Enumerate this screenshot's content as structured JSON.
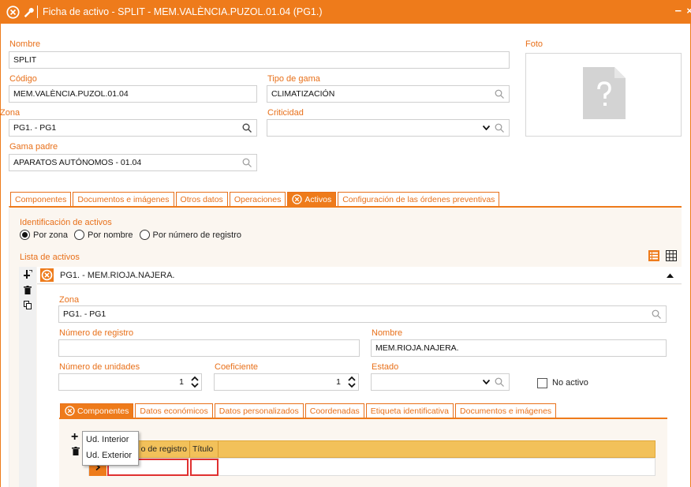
{
  "window": {
    "title": "Ficha de activo -  SPLIT - MEM.VALÈNCIA.PUZOL.01.04 (PG1.)",
    "minimize": "–",
    "close": "×"
  },
  "form": {
    "nombre_label": "Nombre",
    "nombre_value": "SPLIT",
    "codigo_label": "Código",
    "codigo_value": "MEM.VALÈNCIA.PUZOL.01.04",
    "tipo_gama_label": "Tipo de gama",
    "tipo_gama_value": "CLIMATIZACIÓN",
    "zona_label": "Zona",
    "zona_value": "PG1. - PG1",
    "criticidad_label": "Criticidad",
    "criticidad_value": "",
    "gama_padre_label": "Gama padre",
    "gama_padre_value": "APARATOS AUTÓNOMOS - 01.04",
    "foto_label": "Foto"
  },
  "tabs": [
    {
      "label": "Componentes"
    },
    {
      "label": "Documentos e imágenes"
    },
    {
      "label": "Otros datos"
    },
    {
      "label": "Operaciones"
    },
    {
      "label": "Activos"
    },
    {
      "label": "Configuración de las órdenes preventivas"
    }
  ],
  "activos": {
    "identificacion_label": "Identificación de activos",
    "radios": [
      {
        "label": "Por zona",
        "checked": true
      },
      {
        "label": "Por nombre",
        "checked": false
      },
      {
        "label": "Por número de registro",
        "checked": false
      }
    ],
    "lista_label": "Lista de activos",
    "list_item": "PG1. - MEM.RIOJA.NAJERA."
  },
  "detail": {
    "zona_label": "Zona",
    "zona_value": "PG1. - PG1",
    "num_registro_label": "Número de registro",
    "num_registro_value": "",
    "nombre_label": "Nombre",
    "nombre_value": "MEM.RIOJA.NAJERA.",
    "num_unidades_label": "Número de unidades",
    "num_unidades_value": "1",
    "coeficiente_label": "Coeficiente",
    "coeficiente_value": "1",
    "estado_label": "Estado",
    "estado_value": "",
    "no_activo_label": "No activo"
  },
  "subtabs": [
    {
      "label": "Componentes"
    },
    {
      "label": "Datos económicos"
    },
    {
      "label": "Datos personalizados"
    },
    {
      "label": "Coordenadas"
    },
    {
      "label": "Etiqueta identificativa"
    },
    {
      "label": "Documentos e imágenes"
    }
  ],
  "grid": {
    "columns": [
      "o de registro",
      "Título"
    ]
  },
  "popup": {
    "items": [
      "Ud. Interior",
      "Ud. Exterior"
    ]
  },
  "colors": {
    "accent": "#ee7b1b",
    "label": "#e8701a",
    "grid_header": "#f2c15a"
  }
}
